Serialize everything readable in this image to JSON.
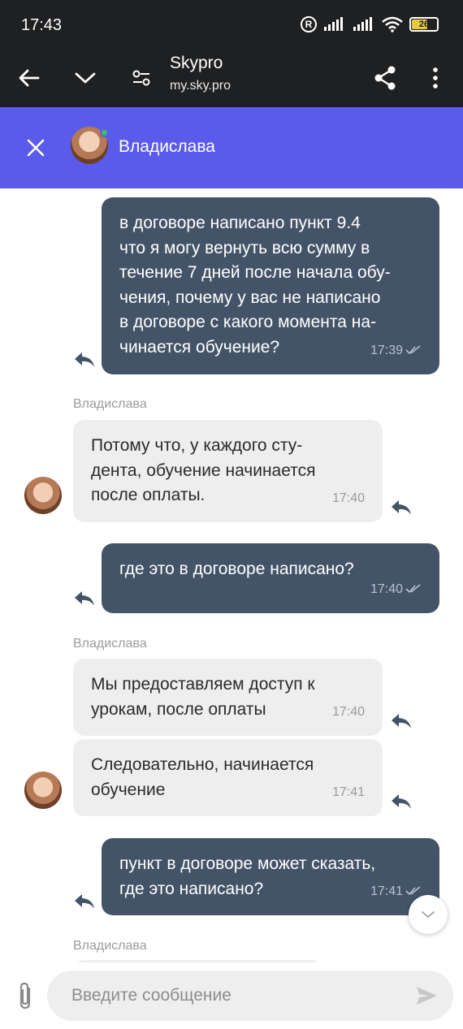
{
  "status_bar": {
    "time": "17:43",
    "reg": "R",
    "battery": "26"
  },
  "browser": {
    "title": "Skypro",
    "url": "my.sky.pro"
  },
  "chat": {
    "contact_name": "Владислава"
  },
  "messages": [
    {
      "type": "out",
      "text": "в договоре написано пункт 9.4\nчто я могу вернуть всю сумму в\nтечение 7 дней после начала обу-\nчения, почему у вас не написано\nв договоре с какого момента на-\nчинается обучение?",
      "time": "17:39"
    },
    {
      "type": "sender",
      "text": "Владислава"
    },
    {
      "type": "in",
      "text": "Потому что, у каждого сту-\nдента, обучение начинается\nпосле оплаты.",
      "time": "17:40"
    },
    {
      "type": "out",
      "text": "где это в договоре написано?",
      "time": "17:40"
    },
    {
      "type": "sender",
      "text": "Владислава"
    },
    {
      "type": "in",
      "text": "Мы предоставляем доступ к\nурокам, после оплаты",
      "time": "17:40"
    },
    {
      "type": "in",
      "text": "Следовательно, начинается\nобучение",
      "time": "17:41"
    },
    {
      "type": "out",
      "text": "пункт в договоре может сказать,\nгде это написано?",
      "time": "17:41"
    },
    {
      "type": "sender",
      "text": "Владислава"
    }
  ],
  "input": {
    "placeholder": "Введите сообщение"
  },
  "colors": {
    "header": "#5a5bea",
    "outgoing": "#445468",
    "incoming": "#eeeeee",
    "toolbar": "#1f2022"
  },
  "icons": {
    "back": "arrow-left-icon",
    "collapse": "chevron-down-icon",
    "settings": "tune-icon",
    "share": "share-icon",
    "more": "more-vertical-icon",
    "close": "close-icon",
    "reply": "reply-icon",
    "read": "double-check-icon",
    "scroll": "chevron-down-icon",
    "attach": "paperclip-icon",
    "send": "send-icon"
  }
}
